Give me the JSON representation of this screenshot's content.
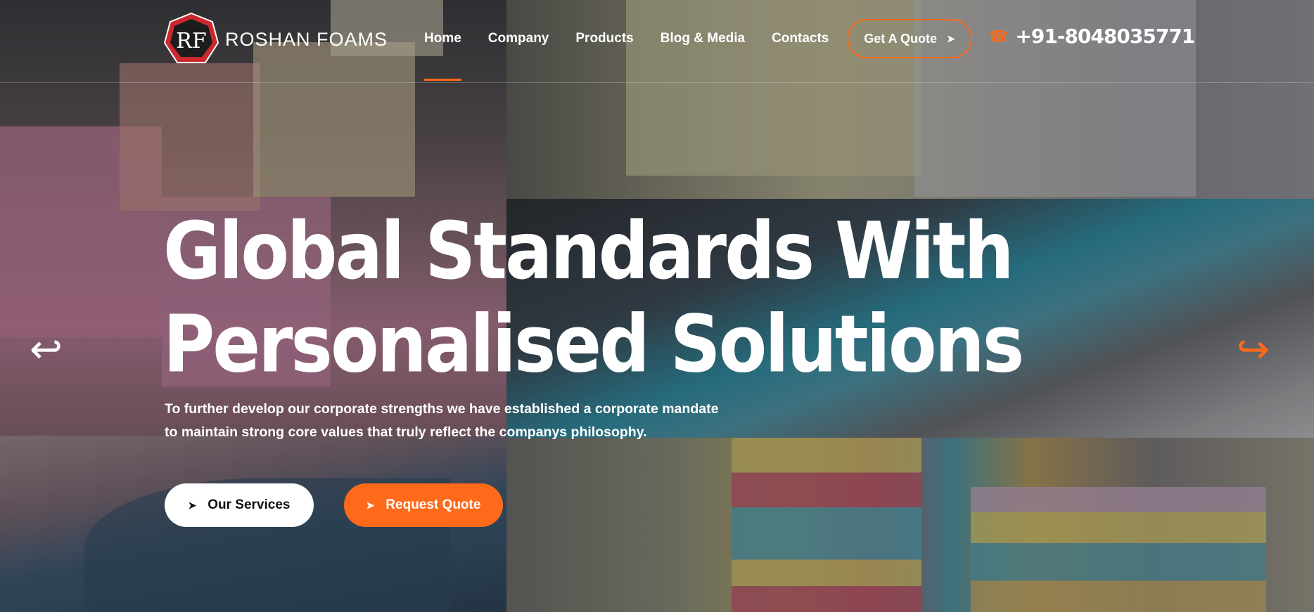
{
  "brand": {
    "name": "ROSHAN FOAMS",
    "monogram": "RF"
  },
  "nav": {
    "items": [
      {
        "label": "Home"
      },
      {
        "label": "Company"
      },
      {
        "label": "Products"
      },
      {
        "label": "Blog & Media"
      },
      {
        "label": "Contacts"
      }
    ],
    "active": "Home"
  },
  "header": {
    "quote_label": "Get A Quote",
    "phone": "+91-8048035771",
    "phone_icon": "phone-icon",
    "arrow_icon": "arrow-right-icon"
  },
  "hero": {
    "title_line1": "Global Standards With",
    "title_line2": "Personalised Solutions",
    "subtitle_line1": "To further develop our corporate strengths we have established a corporate mandate",
    "subtitle_line2": "to maintain strong core values that truly reflect the companys philosophy.",
    "services_label": "Our Services",
    "request_label": "Request Quote"
  },
  "slider": {
    "prev_icon": "arrow-left-icon",
    "next_icon": "arrow-right-icon"
  },
  "colors": {
    "accent": "#ff6a1a",
    "text": "#ffffff"
  }
}
